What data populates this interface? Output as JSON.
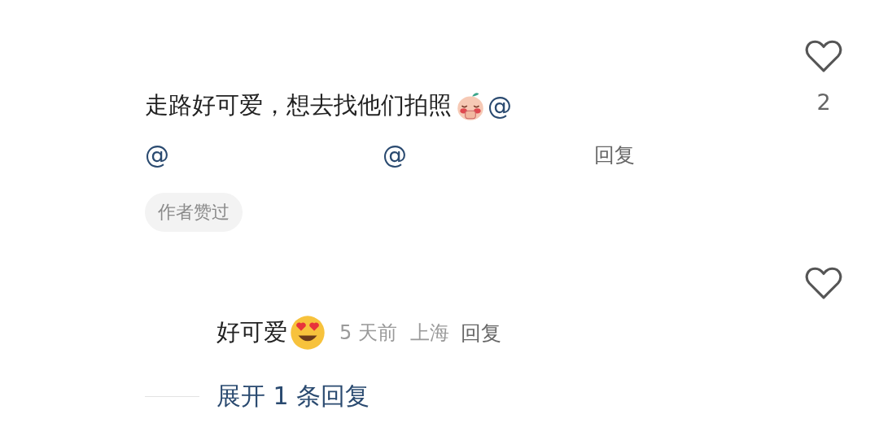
{
  "comments": [
    {
      "text": "走路好可爱，想去找他们拍照",
      "mentions": [
        "@",
        "@",
        "@"
      ],
      "reply_label": "回复",
      "tag": "作者赞过",
      "like_count": "2",
      "liked": false
    },
    {
      "text": "好可爱",
      "time": "5 天前",
      "location": "上海",
      "reply_label": "回复",
      "liked": false,
      "expand_label": "展开 1 条回复"
    }
  ]
}
